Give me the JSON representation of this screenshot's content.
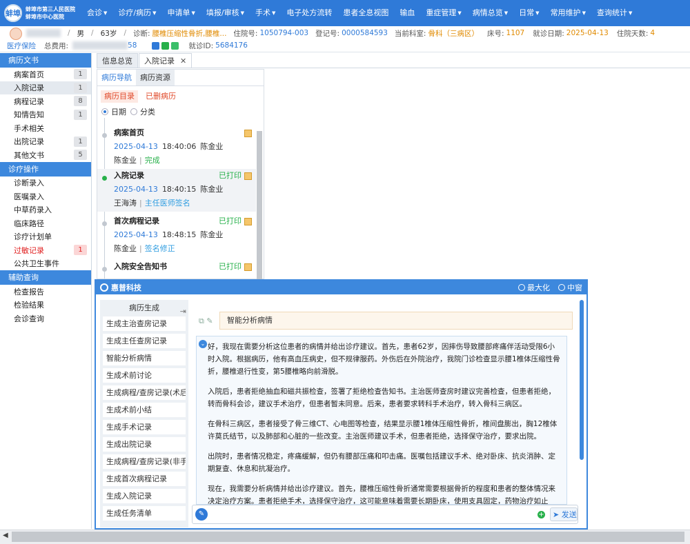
{
  "header": {
    "logo_text": "蚌埠",
    "hospital_name_1": "蚌埠市第三人民医院",
    "hospital_name_2": "蚌埠市中心医院",
    "menu": [
      "会诊",
      "诊疗/病历",
      "申请单",
      "填报/审核",
      "手术",
      "电子处方流转",
      "患者全息视图",
      "输血",
      "重症管理",
      "病情总览",
      "日常",
      "常用维护",
      "查询统计"
    ],
    "menu_has_caret": [
      true,
      true,
      true,
      true,
      true,
      false,
      false,
      false,
      true,
      true,
      true,
      true,
      true
    ]
  },
  "patient": {
    "gender": "男",
    "age": "63岁",
    "diagnosis_label": "诊断:",
    "diagnosis": "腰椎压缩性骨折,腰椎...",
    "admission_no_label": "住院号:",
    "admission_no": "1050794-003",
    "registration_label": "登记号:",
    "registration_no": "0000584593",
    "dept_label": "当前科室:",
    "dept": "骨科（三病区）",
    "bed_label": "床号:",
    "bed": "1107",
    "visit_date_label": "就诊日期:",
    "visit_date": "2025-04-13",
    "days_label": "住院天数:",
    "days": "4",
    "insurance": "医疗保险",
    "total_fee_label": "总费用:",
    "total_fee_suffix": "58",
    "visit_id_label": "就诊ID:",
    "visit_id": "5684176"
  },
  "left_nav": {
    "sections": [
      {
        "title": "病历文书",
        "items": [
          {
            "label": "病案首页",
            "count": "1"
          },
          {
            "label": "入院记录",
            "count": "1",
            "active": true
          },
          {
            "label": "病程记录",
            "count": "8"
          },
          {
            "label": "知情告知",
            "count": "1"
          },
          {
            "label": "手术相关",
            "count": ""
          },
          {
            "label": "出院记录",
            "count": "1"
          },
          {
            "label": "其他文书",
            "count": "5"
          }
        ]
      },
      {
        "title": "诊疗操作",
        "items": [
          {
            "label": "诊断录入",
            "count": ""
          },
          {
            "label": "医嘱录入",
            "count": ""
          },
          {
            "label": "中草药录入",
            "count": ""
          },
          {
            "label": "临床路径",
            "count": ""
          },
          {
            "label": "诊疗计划单",
            "count": ""
          },
          {
            "label": "过敏记录",
            "count": "1",
            "red": true
          },
          {
            "label": "公共卫生事件",
            "count": ""
          }
        ]
      },
      {
        "title": "辅助查询",
        "items": [
          {
            "label": "检查报告",
            "count": ""
          },
          {
            "label": "检验结果",
            "count": ""
          },
          {
            "label": "会诊查询",
            "count": ""
          }
        ]
      }
    ]
  },
  "tabs": {
    "overview": "信息总览",
    "admission": "入院记录",
    "close": "✕"
  },
  "records_panel": {
    "subtab_nav": "病历导航",
    "subtab_resources": "病历资源",
    "tag_catalog": "病历目录",
    "tag_deleted": "已删病历",
    "radio_date": "日期",
    "radio_category": "分类",
    "records": [
      {
        "title": "病案首页",
        "printed": "",
        "date": "2025-04-13",
        "time": "18:40:06",
        "author": "陈金业",
        "signer": "陈金业",
        "status": "完成",
        "status_color": "green"
      },
      {
        "title": "入院记录",
        "printed": "已打印",
        "date": "2025-04-13",
        "time": "18:40:15",
        "author": "陈金业",
        "signer": "王海涛",
        "status": "主任医师签名",
        "status_color": "blue"
      },
      {
        "title": "首次病程记录",
        "printed": "已打印",
        "date": "2025-04-13",
        "time": "18:48:15",
        "author": "陈金业",
        "signer": "陈金业",
        "status": "签名修正",
        "status_color": "blue"
      },
      {
        "title": "入院安全告知书",
        "printed": "已打印",
        "date": "",
        "time": "",
        "author": "",
        "signer": "",
        "status": "",
        "status_color": "blue"
      }
    ]
  },
  "ai_panel": {
    "brand": "惠普科技",
    "maximize": "最大化",
    "close": "中窗",
    "generator_title": "病历生成",
    "generators": [
      "生成主治查房记录",
      "生成主任查房记录",
      "智能分析病情",
      "生成术前讨论",
      "生成病程/查房记录(术后)",
      "生成术前小结",
      "生成手术记录",
      "生成出院记录",
      "生成病程/查房记录(非手术)",
      "生成首次病程记录",
      "生成入院记录",
      "生成任务清单"
    ],
    "question": "智能分析病情",
    "answer": [
      "好，我现在需要分析这位患者的病情并给出诊疗建议。首先，患者62岁，因摔伤导致腰部疼痛伴活动受限6小时入院。根据病历，他有高血压病史，但不规律服药。外伤后在外院治疗，我院门诊检查显示腰1椎体压缩性骨折，腰椎退行性变，第5腰椎略向前滑脱。",
      "入院后，患者拒绝抽血和磁共振检查，签署了拒绝检查告知书。主治医师查房时建议完善检查，但患者拒绝，转而骨科会诊，建议手术治疗，但患者暂未同意。后来，患者要求转科手术治疗，转入骨科三病区。",
      "在骨科三病区，患者接受了骨三维CT、心电图等检查，结果显示腰1椎体压缩性骨折，椎间盘膨出，胸12椎体许莫氏结节，以及肺部和心脏的一些改变。主治医师建议手术，但患者拒绝，选择保守治疗，要求出院。",
      "出院时，患者情况稳定，疼痛缓解，但仍有腰部压痛和叩击痛。医嘱包括建议手术、绝对卧床、抗炎消肿、定期复查、休息和抗凝治疗。",
      "现在，我需要分析病情并给出诊疗建议。首先，腰椎压缩性骨折通常需要根据骨折的程度和患者的整体情况来决定治疗方案。患者拒绝手术，选择保守治疗，这可能意味着需要长期卧床，使用支具固定，药物治疗如止痛、消肿、促进愈合"
    ],
    "send_label": "发送",
    "input_value": ""
  },
  "colors": {
    "primary": "#2f7ad8",
    "section": "#3d88dd",
    "orange": "#e08a00",
    "green": "#27b04a",
    "red": "#e02020"
  }
}
